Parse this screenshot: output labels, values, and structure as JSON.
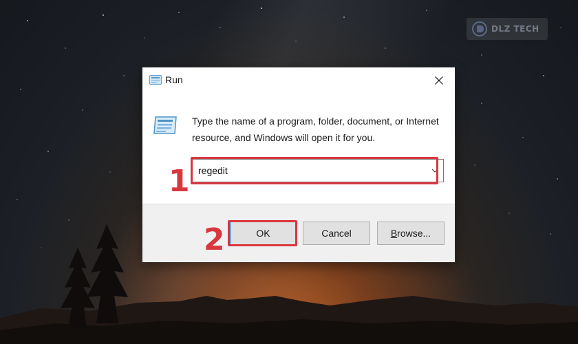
{
  "dialog": {
    "title": "Run",
    "description": "Type the name of a program, folder, document, or Internet resource, and Windows will open it for you.",
    "input": {
      "value": "regedit"
    },
    "buttons": {
      "ok": "OK",
      "cancel": "Cancel",
      "browse_underlined": "B",
      "browse_rest": "rowse..."
    },
    "icons": {
      "title": "run-icon",
      "program": "run-program-icon",
      "close": "close-icon",
      "dropdown": "chevron-down-icon"
    }
  },
  "annotations": {
    "step1": "1",
    "step2": "2",
    "highlight_color": "#d9363e"
  },
  "watermark": {
    "text": "DLZ TECH",
    "icon": "watermark-logo-icon"
  }
}
